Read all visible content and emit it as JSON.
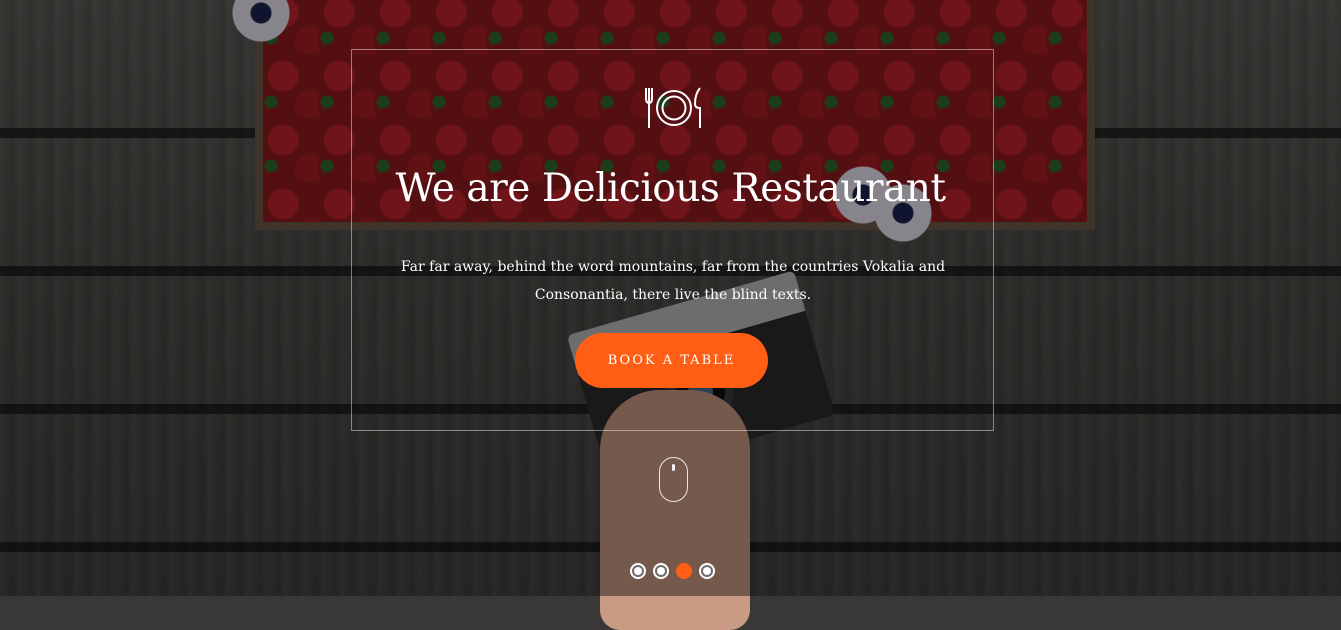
{
  "hero": {
    "title": "We are Delicious Restaurant",
    "subtitle": "Far far away, behind the word mountains, far from the countries Vokalia and Consonantia, there live the blind texts.",
    "button_label": "BOOK A TABLE",
    "logo_icon": "plate-fork-knife-icon",
    "scroll_icon": "mouse-scroll-icon"
  },
  "slider": {
    "total_slides": 4,
    "active_slide": 3
  },
  "colors": {
    "accent": "#ff5e14",
    "text": "#ffffff",
    "frame_border": "rgba(255,255,255,0.45)"
  }
}
